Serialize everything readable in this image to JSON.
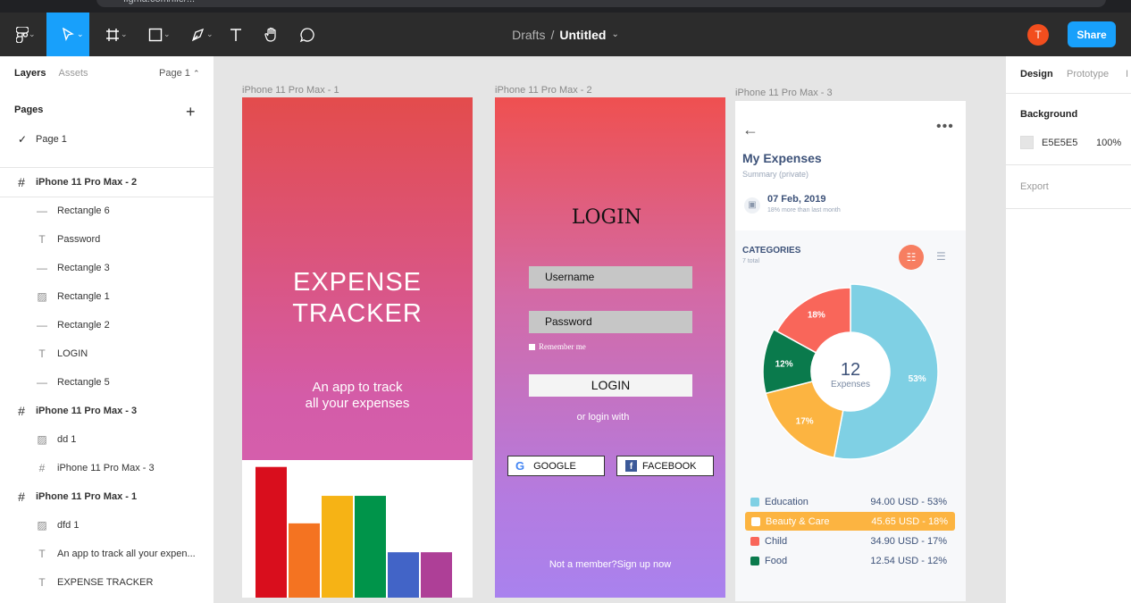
{
  "browser": {
    "url": "figma.com/file/..."
  },
  "toolbar": {
    "breadcrumb_folder": "Drafts",
    "breadcrumb_sep": "/",
    "file_name": "Untitled",
    "avatar_initial": "T",
    "share_label": "Share",
    "accent": "#18a0fb"
  },
  "left_panel": {
    "tab_layers": "Layers",
    "tab_assets": "Assets",
    "page_selector": "Page 1",
    "pages_heading": "Pages",
    "pages": [
      {
        "label": "Page 1",
        "selected": true
      }
    ],
    "layers": [
      {
        "label": "iPhone 11 Pro Max - 2",
        "kind": "frame",
        "level": 0
      },
      {
        "label": "Rectangle 6",
        "kind": "rectangle",
        "level": 1
      },
      {
        "label": "Password",
        "kind": "text",
        "level": 1
      },
      {
        "label": "Rectangle 3",
        "kind": "rectangle",
        "level": 1
      },
      {
        "label": "Rectangle 1",
        "kind": "image",
        "level": 1
      },
      {
        "label": "Rectangle 2",
        "kind": "rectangle",
        "level": 1
      },
      {
        "label": "LOGIN",
        "kind": "text",
        "level": 1
      },
      {
        "label": "Rectangle 5",
        "kind": "rectangle",
        "level": 1
      },
      {
        "label": "iPhone 11 Pro Max - 3",
        "kind": "frame",
        "level": 0
      },
      {
        "label": "dd 1",
        "kind": "image",
        "level": 1
      },
      {
        "label": "iPhone 11 Pro Max - 3",
        "kind": "frame",
        "level": 1
      },
      {
        "label": "iPhone 11 Pro Max - 1",
        "kind": "frame",
        "level": 0
      },
      {
        "label": "dfd 1",
        "kind": "image",
        "level": 1
      },
      {
        "label": "An app to track all your expen...",
        "kind": "text",
        "level": 1
      },
      {
        "label": "EXPENSE TRACKER",
        "kind": "text",
        "level": 1
      }
    ]
  },
  "right_panel": {
    "tab_design": "Design",
    "tab_prototype": "Prototype",
    "background_heading": "Background",
    "background_hex": "E5E5E5",
    "background_opacity": "100%",
    "export_heading": "Export"
  },
  "canvas": {
    "frame1": {
      "label": "iPhone 11 Pro Max - 1",
      "title_line1": "EXPENSE",
      "title_line2": "TRACKER",
      "subtitle_line1": "An app to track",
      "subtitle_line2": "all your expenses",
      "bar_colors": [
        "#d90e1d",
        "#f47321",
        "#f6b315",
        "#00944a",
        "#4264c7",
        "#ae3f97"
      ],
      "bar_levels": [
        0.95,
        0.54,
        0.74,
        0.74,
        0.33,
        0.33
      ]
    },
    "frame2": {
      "label": "iPhone 11 Pro Max - 2",
      "title": "LOGIN",
      "username_placeholder": "Username",
      "password_placeholder": "Password",
      "remember": "Remember me",
      "login_button": "LOGIN",
      "or_text": "or login with",
      "google": "GOOGLE",
      "facebook": "FACEBOOK",
      "google_glyph": "G",
      "facebook_glyph": "f",
      "signup": "Not a member?Sign up now"
    },
    "frame3": {
      "label": "iPhone 11 Pro Max - 3",
      "title": "My Expenses",
      "subtitle": "Summary (private)",
      "date": "07 Feb, 2019",
      "date_sub": "18% more than last month",
      "categories_heading": "CATEGORIES",
      "categories_sub": "7 total",
      "center_number": "12",
      "center_label": "Expenses",
      "slices": [
        {
          "name": "Education",
          "percent": 53,
          "label": "53%",
          "color": "#7fd0e4",
          "amount": "94.00 USD - 53%"
        },
        {
          "name": "Beauty & Care",
          "percent": 18,
          "label": "17%",
          "color": "#fcb441",
          "amount": "45.65 USD - 18%"
        },
        {
          "name": "Food",
          "percent": 12,
          "label": "12%",
          "color": "#0a7a4c",
          "amount": "12.54 USD - 12%"
        },
        {
          "name": "Child",
          "percent": 17,
          "label": "18%",
          "color": "#f9665a",
          "amount": "34.90 USD - 17%"
        }
      ],
      "legend": [
        {
          "name": "Education",
          "amount": "94.00 USD - 53%",
          "color": "#7fd0e4",
          "highlighted": false
        },
        {
          "name": "Beauty & Care",
          "amount": "45.65 USD - 18%",
          "color": "#fcb441",
          "highlighted": true
        },
        {
          "name": "Child",
          "amount": "34.90 USD - 17%",
          "color": "#f9665a",
          "highlighted": false
        },
        {
          "name": "Food",
          "amount": "12.54 USD - 12%",
          "color": "#0a7a4c",
          "highlighted": false
        }
      ]
    }
  }
}
